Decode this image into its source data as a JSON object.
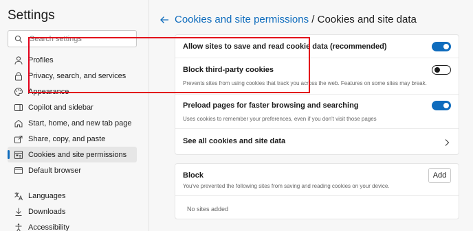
{
  "sidebar": {
    "title": "Settings",
    "search_placeholder": "Search settings",
    "items": [
      {
        "label": "Profiles"
      },
      {
        "label": "Privacy, search, and services"
      },
      {
        "label": "Appearance"
      },
      {
        "label": "Copilot and sidebar"
      },
      {
        "label": "Start, home, and new tab page"
      },
      {
        "label": "Share, copy, and paste"
      },
      {
        "label": "Cookies and site permissions"
      },
      {
        "label": "Default browser"
      },
      {
        "label": "Languages"
      },
      {
        "label": "Downloads"
      },
      {
        "label": "Accessibility"
      }
    ],
    "active_index": 6
  },
  "header": {
    "breadcrumb": "Cookies and site permissions",
    "separator": "/",
    "current": "Cookies and site data"
  },
  "settings": {
    "allow_cookies": {
      "label": "Allow sites to save and read cookie data (recommended)",
      "enabled": true
    },
    "block_third_party": {
      "label": "Block third-party cookies",
      "description": "Prevents sites from using cookies that track you across the web. Features on some sites may break.",
      "enabled": false
    },
    "preload": {
      "label": "Preload pages for faster browsing and searching",
      "description": "Uses cookies to remember your preferences, even if you don't visit those pages",
      "enabled": true
    },
    "see_all": {
      "label": "See all cookies and site data"
    }
  },
  "block": {
    "title": "Block",
    "description": "You've prevented the following sites from saving and reading cookies on your device.",
    "add_label": "Add",
    "empty_text": "No sites added"
  },
  "colors": {
    "accent": "#0f6cbd",
    "highlight": "#e2001a"
  }
}
